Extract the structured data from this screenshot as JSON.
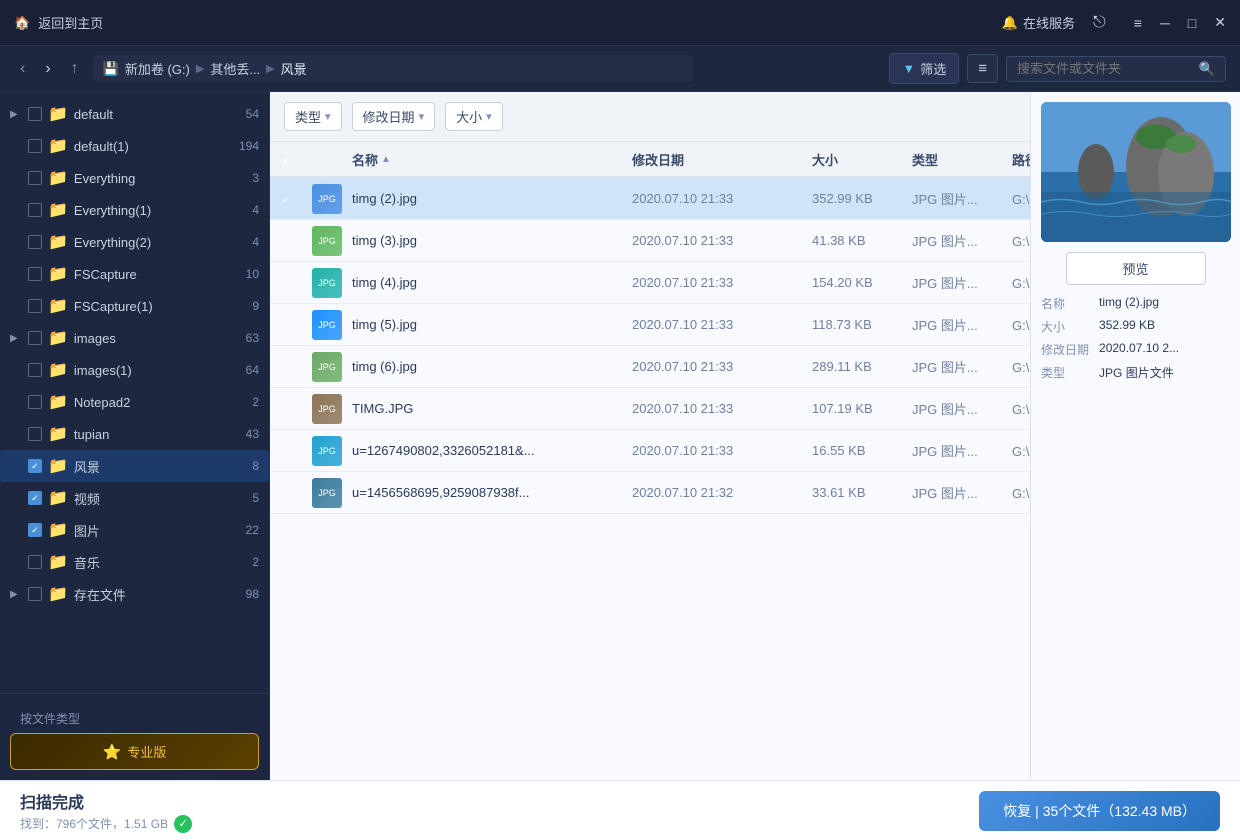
{
  "titleBar": {
    "homeLabel": "返回到主页",
    "onlineService": "在线服务",
    "menuIcon": "≡",
    "minimizeIcon": "─",
    "maximizeIcon": "□",
    "closeIcon": "✕"
  },
  "navBar": {
    "breadcrumb": {
      "drive": "新加卷 (G:)",
      "sep1": "▶",
      "folder": "其他丢...",
      "sep2": "▶",
      "current": "风景"
    },
    "filterLabel": "筛选",
    "searchPlaceholder": "搜索文件或文件夹"
  },
  "filterTags": [
    {
      "label": "类型",
      "arrow": "▾"
    },
    {
      "label": "修改日期",
      "arrow": "▾"
    },
    {
      "label": "大小",
      "arrow": "▾"
    }
  ],
  "tableHeader": {
    "name": "名称",
    "modDate": "修改日期",
    "size": "大小",
    "type": "类型",
    "path": "路径"
  },
  "files": [
    {
      "selected": true,
      "checked": true,
      "name": "timg (2).jpg",
      "modDate": "2020.07.10 21:33",
      "size": "352.99 KB",
      "type": "JPG 图片...",
      "path": "G:\\风景",
      "thumbClass": "thumb-blue"
    },
    {
      "selected": false,
      "checked": true,
      "name": "timg (3).jpg",
      "modDate": "2020.07.10 21:33",
      "size": "41.38 KB",
      "type": "JPG 图片...",
      "path": "G:\\风景",
      "thumbClass": "thumb-green"
    },
    {
      "selected": false,
      "checked": true,
      "name": "timg (4).jpg",
      "modDate": "2020.07.10 21:33",
      "size": "154.20 KB",
      "type": "JPG 图片...",
      "path": "G:\\风景",
      "thumbClass": "thumb-teal"
    },
    {
      "selected": false,
      "checked": true,
      "name": "timg (5).jpg",
      "modDate": "2020.07.10 21:33",
      "size": "118.73 KB",
      "type": "JPG 图片...",
      "path": "G:\\风景",
      "thumbClass": "thumb-ocean"
    },
    {
      "selected": false,
      "checked": true,
      "name": "timg (6).jpg",
      "modDate": "2020.07.10 21:33",
      "size": "289.11 KB",
      "type": "JPG 图片...",
      "path": "G:\\风景",
      "thumbClass": "thumb-mountain"
    },
    {
      "selected": false,
      "checked": true,
      "name": "TIMG.JPG",
      "modDate": "2020.07.10 21:33",
      "size": "107.19 KB",
      "type": "JPG 图片...",
      "path": "G:\\风景",
      "thumbClass": "thumb-rocky"
    },
    {
      "selected": false,
      "checked": true,
      "name": "u=1267490802,3326052181&...",
      "modDate": "2020.07.10 21:33",
      "size": "16.55 KB",
      "type": "JPG 图片...",
      "path": "G:\\风景",
      "thumbClass": "thumb-wave"
    },
    {
      "selected": false,
      "checked": true,
      "name": "u=1456568695,9259087938f...",
      "modDate": "2020.07.10 21:32",
      "size": "33.61 KB",
      "type": "JPG 图片...",
      "path": "G:\\风景",
      "thumbClass": "thumb-coast"
    }
  ],
  "sidebar": {
    "items": [
      {
        "label": "default",
        "count": "54",
        "checked": false,
        "expanded": true,
        "indent": 0
      },
      {
        "label": "default(1)",
        "count": "194",
        "checked": false,
        "expanded": false,
        "indent": 0
      },
      {
        "label": "Everything",
        "count": "3",
        "checked": false,
        "expanded": false,
        "indent": 0
      },
      {
        "label": "Everything(1)",
        "count": "4",
        "checked": false,
        "expanded": false,
        "indent": 0
      },
      {
        "label": "Everything(2)",
        "count": "4",
        "checked": false,
        "expanded": false,
        "indent": 0
      },
      {
        "label": "FSCapture",
        "count": "10",
        "checked": false,
        "expanded": false,
        "indent": 0
      },
      {
        "label": "FSCapture(1)",
        "count": "9",
        "checked": false,
        "expanded": false,
        "indent": 0
      },
      {
        "label": "images",
        "count": "63",
        "checked": false,
        "expanded": true,
        "indent": 0
      },
      {
        "label": "images(1)",
        "count": "64",
        "checked": false,
        "expanded": false,
        "indent": 0
      },
      {
        "label": "Notepad2",
        "count": "2",
        "checked": false,
        "expanded": false,
        "indent": 0
      },
      {
        "label": "tupian",
        "count": "43",
        "checked": false,
        "expanded": false,
        "indent": 0
      },
      {
        "label": "风景",
        "count": "8",
        "checked": true,
        "expanded": false,
        "selected": true,
        "indent": 0
      },
      {
        "label": "视频",
        "count": "5",
        "checked": true,
        "expanded": false,
        "indent": 0
      },
      {
        "label": "图片",
        "count": "22",
        "checked": true,
        "expanded": false,
        "indent": 0
      },
      {
        "label": "音乐",
        "count": "2",
        "checked": false,
        "expanded": false,
        "indent": 0
      },
      {
        "label": "存在文件",
        "count": "98",
        "checked": false,
        "expanded": true,
        "indent": 0
      }
    ],
    "fileTypeLabel": "按文件类型",
    "proLabel": "专业版"
  },
  "preview": {
    "buttonLabel": "预览",
    "meta": {
      "nameLabel": "名称",
      "nameValue": "timg (2).jpg",
      "sizeLabel": "大小",
      "sizeValue": "352.99 KB",
      "dateLabel": "修改日期",
      "dateValue": "2020.07.10 2...",
      "typeLabel": "类型",
      "typeValue": "JPG 图片文件"
    }
  },
  "statusBar": {
    "scanComplete": "扫描完成",
    "detail": "找到：796个文件，1.51 GB",
    "recoverLabel": "恢复 | 35个文件（132.43 MB）"
  }
}
